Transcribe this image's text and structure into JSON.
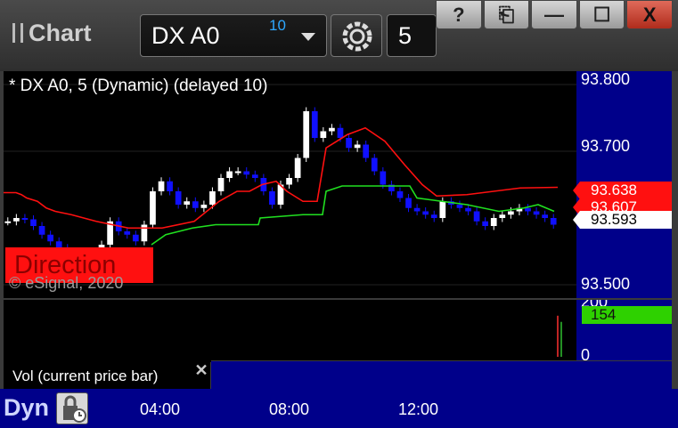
{
  "window": {
    "title": "Chart",
    "symbol": "DX A0",
    "delay_badge": "10",
    "interval": "5",
    "buttons": [
      "?",
      "⎗",
      "—",
      "☐",
      "X"
    ]
  },
  "chart": {
    "title": "* DX A0, 5 (Dynamic) (delayed 10)",
    "copyright": "© eSignal, 2020",
    "direction_label": "Direction",
    "price_tags": {
      "upper": "93.638",
      "middle": "93.607",
      "last": "93.593"
    }
  },
  "volume": {
    "legend": "Vol (current price bar)",
    "last_value": "154",
    "axis_labels": [
      "200",
      "0"
    ]
  },
  "footer": {
    "mode_label": "Dyn"
  },
  "colors": {
    "background": "#000000",
    "axis": "#00008a",
    "candle_up": "#ffffff",
    "candle_down": "#1010ff",
    "upper_band": "#ff1010",
    "lower_band": "#20e020"
  },
  "chart_data": {
    "type": "candlestick",
    "y_ticks": [
      "93.800",
      "93.700",
      "93.500"
    ],
    "ylim": [
      93.48,
      93.82
    ],
    "x_ticks": [
      "04:00",
      "08:00",
      "12:00"
    ],
    "time_range": [
      "00:00",
      "15:50"
    ],
    "close_series": [
      93.595,
      93.6,
      93.598,
      93.588,
      93.575,
      93.565,
      93.555,
      93.545,
      93.54,
      93.535,
      93.545,
      93.56,
      93.595,
      93.58,
      93.575,
      93.565,
      93.59,
      93.64,
      93.655,
      93.64,
      93.62,
      93.625,
      93.615,
      93.62,
      93.64,
      93.66,
      93.67,
      93.67,
      93.665,
      93.66,
      93.64,
      93.62,
      93.65,
      93.66,
      93.69,
      93.76,
      93.72,
      93.73,
      93.735,
      93.72,
      93.705,
      93.71,
      93.69,
      93.67,
      93.65,
      93.64,
      93.63,
      93.615,
      93.61,
      93.605,
      93.6,
      93.625,
      93.62,
      93.615,
      93.61,
      93.595,
      93.588,
      93.6,
      93.605,
      93.61,
      93.615,
      93.61,
      93.605,
      93.6,
      93.59
    ],
    "upper_band": [
      [
        0,
        93.638
      ],
      [
        14,
        93.638
      ],
      [
        20,
        93.635
      ],
      [
        26,
        93.63
      ],
      [
        38,
        93.625
      ],
      [
        48,
        93.615
      ],
      [
        58,
        93.61
      ],
      [
        76,
        93.605
      ],
      [
        104,
        93.595
      ],
      [
        140,
        93.585
      ],
      [
        178,
        93.585
      ],
      [
        214,
        93.595
      ],
      [
        242,
        93.625
      ],
      [
        262,
        93.64
      ],
      [
        276,
        93.64
      ],
      [
        290,
        93.65
      ],
      [
        306,
        93.655
      ],
      [
        318,
        93.64
      ],
      [
        336,
        93.625
      ],
      [
        352,
        93.625
      ],
      [
        362,
        93.705
      ],
      [
        386,
        93.725
      ],
      [
        406,
        93.735
      ],
      [
        428,
        93.715
      ],
      [
        450,
        93.68
      ],
      [
        470,
        93.65
      ],
      [
        486,
        93.633
      ],
      [
        520,
        93.635
      ],
      [
        580,
        93.645
      ],
      [
        622,
        93.646
      ]
    ],
    "lower_band": [
      [
        166,
        93.56
      ],
      [
        182,
        93.575
      ],
      [
        212,
        93.585
      ],
      [
        238,
        93.59
      ],
      [
        286,
        93.59
      ],
      [
        288,
        93.6
      ],
      [
        336,
        93.605
      ],
      [
        358,
        93.605
      ],
      [
        362,
        93.64
      ],
      [
        380,
        93.648
      ],
      [
        456,
        93.648
      ],
      [
        464,
        93.63
      ],
      [
        492,
        93.625
      ],
      [
        520,
        93.62
      ],
      [
        556,
        93.61
      ],
      [
        584,
        93.615
      ],
      [
        600,
        93.62
      ],
      [
        618,
        93.61
      ]
    ],
    "volume_spike": 154,
    "volume_ylim": [
      0,
      200
    ]
  }
}
